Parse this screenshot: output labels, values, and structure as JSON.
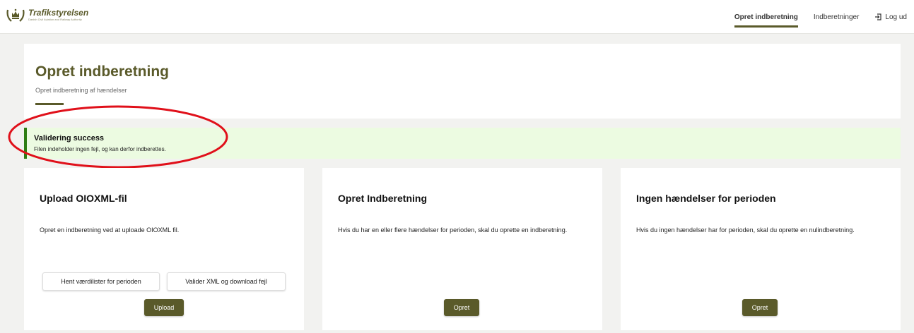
{
  "header": {
    "logo_name": "Trafikstyrelsen",
    "logo_sub": "Danish Civil Aviation and Railway Authority",
    "nav": [
      {
        "label": "Opret indberetning",
        "active": true
      },
      {
        "label": "Indberetninger",
        "active": false
      },
      {
        "label": "Log ud",
        "icon": "logout-icon"
      }
    ]
  },
  "page": {
    "title": "Opret indberetning",
    "subtitle": "Opret indberetning af hændelser"
  },
  "alert": {
    "title": "Validering success",
    "text": "Filen indeholder ingen fejl, og kan derfor indberettes.",
    "color": "#2e7d13"
  },
  "cards": [
    {
      "title": "Upload OIOXML-fil",
      "text": "Opret en indberetning ved at uploade OIOXML fil.",
      "buttons": {
        "hent": "Hent værdilister for perioden",
        "valider": "Valider XML og download fejl",
        "primary": "Upload"
      }
    },
    {
      "title": "Opret Indberetning",
      "text": "Hvis du har en eller flere hændelser for perioden, skal du oprette en indberetning.",
      "buttons": {
        "primary": "Opret"
      }
    },
    {
      "title": "Ingen hændelser for perioden",
      "text": "Hvis du ingen hændelser har for perioden, skal du oprette en nulindberetning.",
      "buttons": {
        "primary": "Opret"
      }
    }
  ],
  "colors": {
    "brand": "#5a5a2a",
    "annotation": "#e0101a"
  }
}
